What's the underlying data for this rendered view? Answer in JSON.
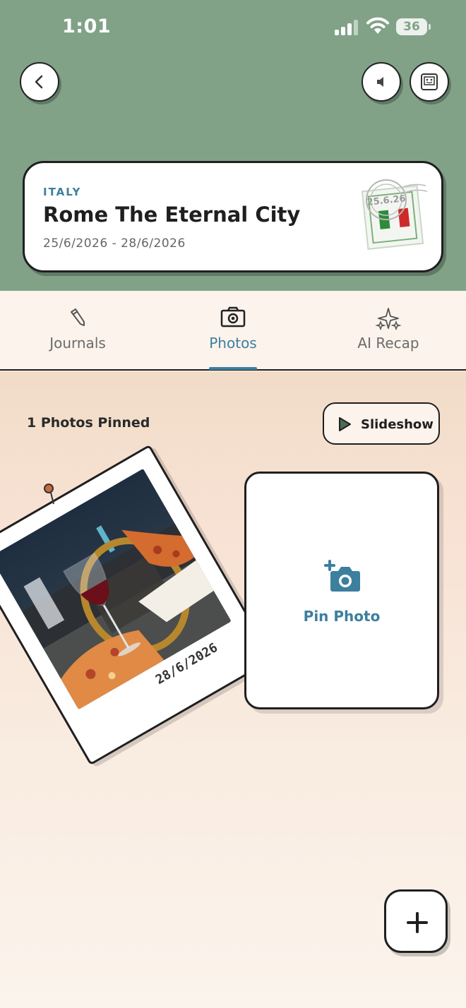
{
  "status_bar": {
    "time": "1:01",
    "battery": "36"
  },
  "header": {
    "back_icon": "chevron-left-icon",
    "sound_icon": "speaker-icon",
    "frame_icon": "photo-frame-icon"
  },
  "trip": {
    "country": "ITALY",
    "title": "Rome The Eternal City",
    "dates": "25/6/2026 - 28/6/2026",
    "stamp_date": "25.6.26"
  },
  "tabs": [
    {
      "label": "Journals",
      "icon": "pencil-icon",
      "active": false
    },
    {
      "label": "Photos",
      "icon": "camera-icon",
      "active": true
    },
    {
      "label": "AI Recap",
      "icon": "sparkle-icon",
      "active": false
    }
  ],
  "photos": {
    "pinned_count_label": "1 Photos Pinned",
    "slideshow_label": "Slideshow",
    "items": [
      {
        "date": "28/6/2026"
      }
    ],
    "pin_photo_label": "Pin Photo"
  },
  "colors": {
    "header_bg": "#81a287",
    "accent": "#3d7f9e",
    "outline": "#1f1f1f"
  }
}
